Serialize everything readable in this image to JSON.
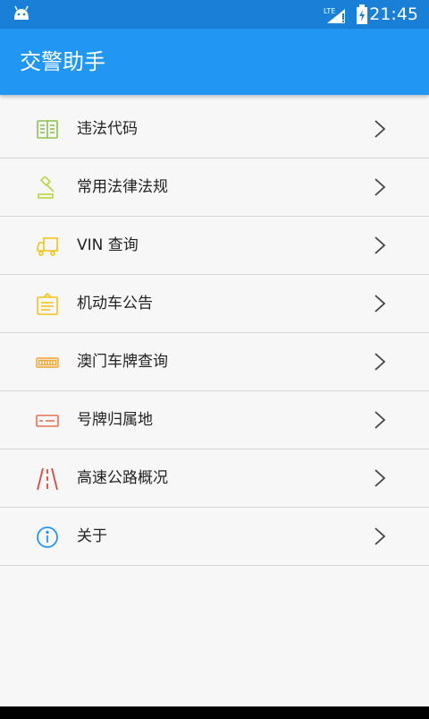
{
  "status_bar": {
    "network": "LTE",
    "time": "21:45"
  },
  "app_bar": {
    "title": "交警助手"
  },
  "menu": {
    "items": [
      {
        "label": "违法代码",
        "icon": "book-icon",
        "color": "#8bc34a"
      },
      {
        "label": "常用法律法规",
        "icon": "gavel-icon",
        "color": "#b7d53a"
      },
      {
        "label": "VIN 查询",
        "icon": "truck-icon",
        "color": "#f0c419"
      },
      {
        "label": "机动车公告",
        "icon": "notice-board-icon",
        "color": "#f0c419"
      },
      {
        "label": "澳门车牌查询",
        "icon": "license-plate-icon",
        "color": "#f1a32c"
      },
      {
        "label": "号牌归属地",
        "icon": "card-icon",
        "color": "#e8704d"
      },
      {
        "label": "高速公路概况",
        "icon": "highway-icon",
        "color": "#d84a3b"
      },
      {
        "label": "关于",
        "icon": "info-icon",
        "color": "#2196f3"
      }
    ]
  }
}
